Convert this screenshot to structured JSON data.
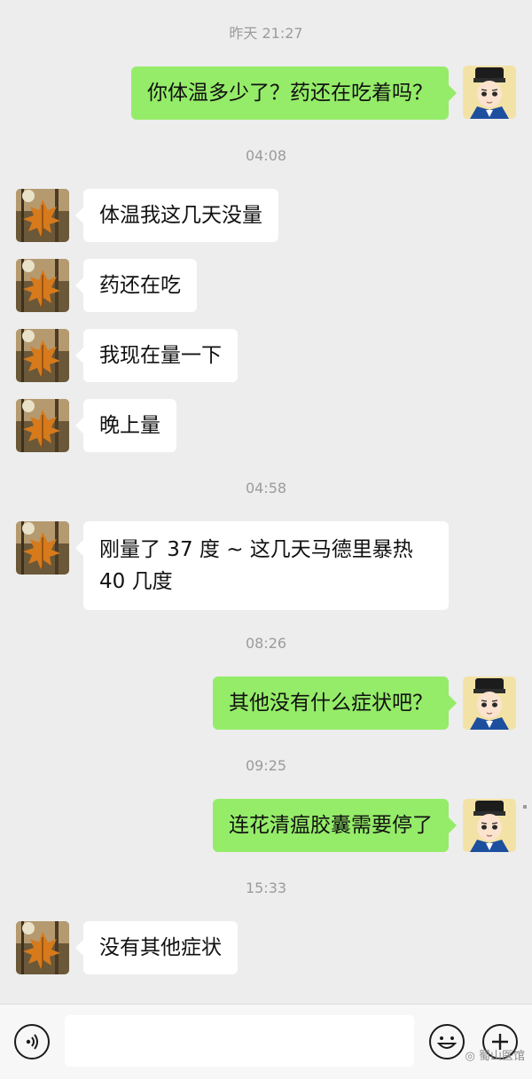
{
  "conversation": {
    "timestamps": [
      "昨天 21:27",
      "04:08",
      "04:58",
      "08:26",
      "09:25",
      "15:33"
    ],
    "messages": [
      {
        "from": "me",
        "text": "你体温多少了？药还在吃着吗？"
      },
      {
        "from": "contact",
        "text": "体温我这几天没量"
      },
      {
        "from": "contact",
        "text": "药还在吃"
      },
      {
        "from": "contact",
        "text": "我现在量一下"
      },
      {
        "from": "contact",
        "text": "晚上量"
      },
      {
        "from": "contact",
        "text": "刚量了 37 度 ~ 这几天马德里暴热 40 几度"
      },
      {
        "from": "me",
        "text": "其他没有什么症状吧？"
      },
      {
        "from": "me",
        "text": "连花清瘟胶囊需要停了"
      },
      {
        "from": "contact",
        "text": "没有其他症状"
      }
    ]
  },
  "input_bar": {
    "voice_icon": "voice-icon",
    "emoji_icon": "emoji-icon",
    "plus_icon": "plus-icon",
    "input_value": ""
  },
  "watermark": {
    "text": "蜀山医馆"
  },
  "colors": {
    "background": "#ededed",
    "outgoing_bubble": "#95ec69",
    "incoming_bubble": "#ffffff",
    "timestamp_text": "#9b9b9b"
  }
}
